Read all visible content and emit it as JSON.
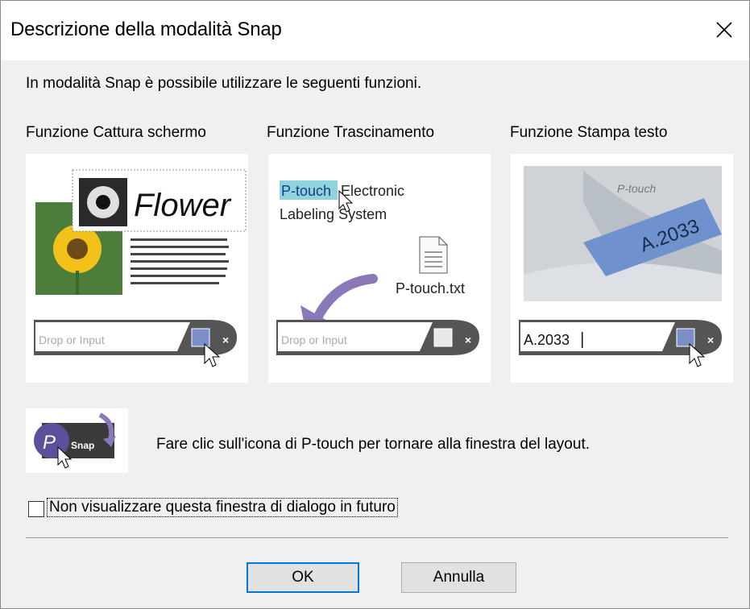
{
  "window": {
    "title": "Descrizione della modalità Snap"
  },
  "intro": "In modalità Snap è possibile utilizzare le seguenti funzioni.",
  "features": [
    {
      "title": "Funzione Cattura schermo",
      "input_placeholder": "Drop or Input",
      "preview_word": "Flower"
    },
    {
      "title": "Funzione Trascinamento",
      "input_placeholder": "Drop or Input",
      "highlight_text": "P-touch",
      "text_line1_rest": "Electronic",
      "text_line2": "Labeling System",
      "file_name": "P-touch.txt"
    },
    {
      "title": "Funzione Stampa testo",
      "input_value": "A.2033",
      "tape_text": "A.2033"
    }
  ],
  "snap_badge": "Snap",
  "hint": "Fare clic sull'icona di P-touch per tornare alla finestra del layout.",
  "checkbox": {
    "label": "Non visualizzare questa finestra di dialogo in futuro",
    "checked": false
  },
  "buttons": {
    "ok": "OK",
    "cancel": "Annulla"
  },
  "colors": {
    "ok_border": "#0078d7",
    "highlight": "#8fd3dc",
    "arrow": "#8a78b8"
  }
}
